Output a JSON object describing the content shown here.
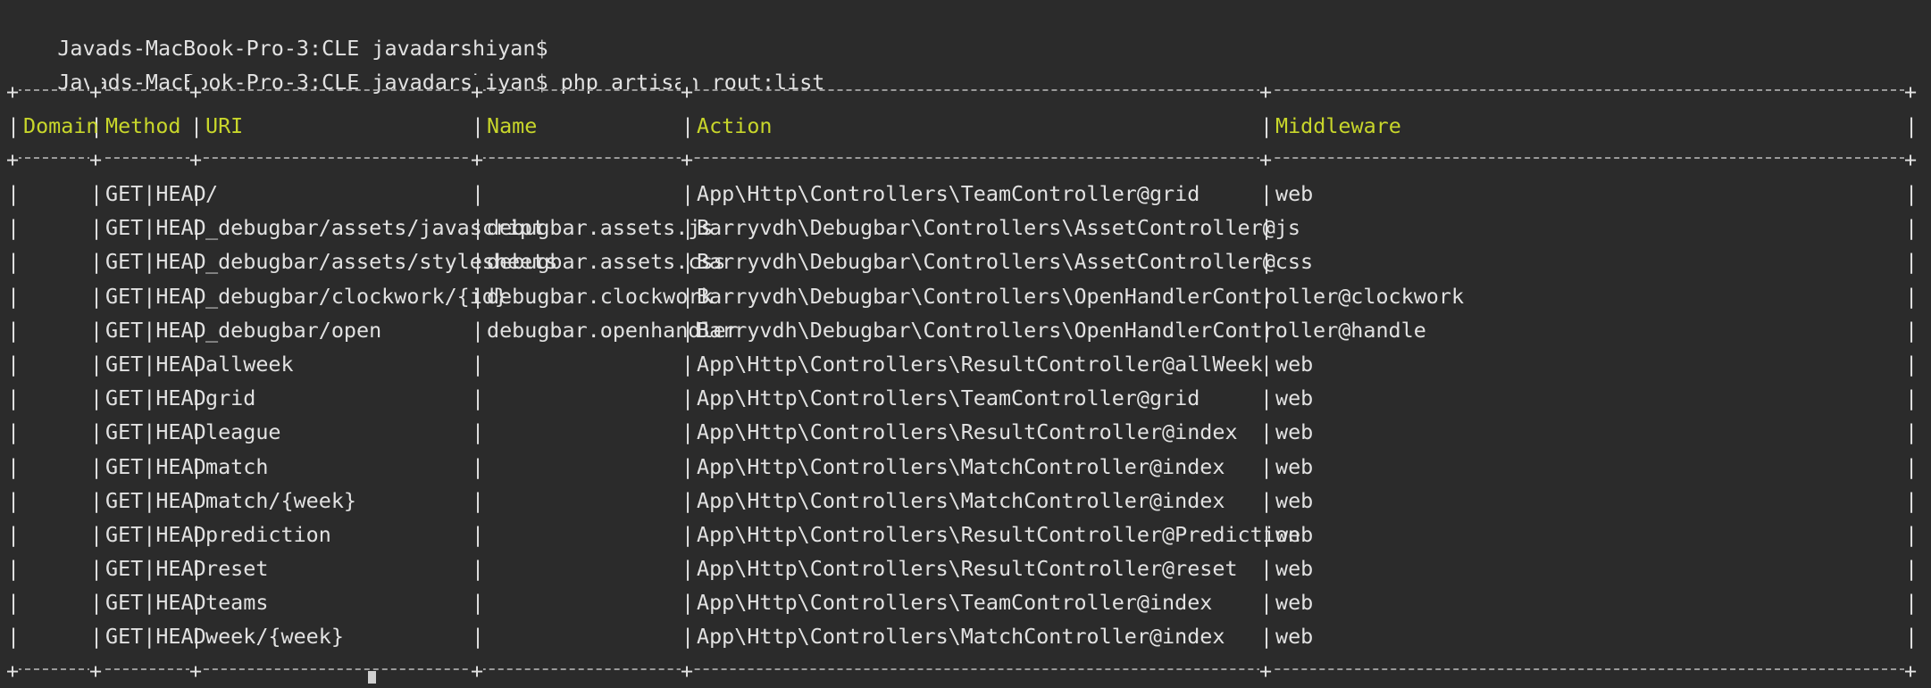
{
  "terminal": {
    "line1": "Javads-MacBook-Pro-3:CLE javadarshiyan$",
    "line2_prompt": "Javads-MacBook-Pro-3:CLE javadarshiyan$",
    "line2_command": " php artisan rout:list"
  },
  "table": {
    "headers": {
      "domain": "Domain",
      "method": "Method",
      "uri": "URI",
      "name": "Name",
      "action": "Action",
      "middleware": "Middleware"
    },
    "rows": [
      {
        "domain": "",
        "method": "GET|HEAD",
        "uri": "/",
        "name": "",
        "action": "App\\Http\\Controllers\\TeamController@grid",
        "middleware": "web"
      },
      {
        "domain": "",
        "method": "GET|HEAD",
        "uri": "_debugbar/assets/javascript",
        "name": "debugbar.assets.js",
        "action": "Barryvdh\\Debugbar\\Controllers\\AssetController@js",
        "middleware": ""
      },
      {
        "domain": "",
        "method": "GET|HEAD",
        "uri": "_debugbar/assets/stylesheets",
        "name": "debugbar.assets.css",
        "action": "Barryvdh\\Debugbar\\Controllers\\AssetController@css",
        "middleware": ""
      },
      {
        "domain": "",
        "method": "GET|HEAD",
        "uri": "_debugbar/clockwork/{id}",
        "name": "debugbar.clockwork",
        "action": "Barryvdh\\Debugbar\\Controllers\\OpenHandlerController@clockwork",
        "middleware": ""
      },
      {
        "domain": "",
        "method": "GET|HEAD",
        "uri": "_debugbar/open",
        "name": "debugbar.openhandler",
        "action": "Barryvdh\\Debugbar\\Controllers\\OpenHandlerController@handle",
        "middleware": ""
      },
      {
        "domain": "",
        "method": "GET|HEAD",
        "uri": "allweek",
        "name": "",
        "action": "App\\Http\\Controllers\\ResultController@allWeek",
        "middleware": "web"
      },
      {
        "domain": "",
        "method": "GET|HEAD",
        "uri": "grid",
        "name": "",
        "action": "App\\Http\\Controllers\\TeamController@grid",
        "middleware": "web"
      },
      {
        "domain": "",
        "method": "GET|HEAD",
        "uri": "league",
        "name": "",
        "action": "App\\Http\\Controllers\\ResultController@index",
        "middleware": "web"
      },
      {
        "domain": "",
        "method": "GET|HEAD",
        "uri": "match",
        "name": "",
        "action": "App\\Http\\Controllers\\MatchController@index",
        "middleware": "web"
      },
      {
        "domain": "",
        "method": "GET|HEAD",
        "uri": "match/{week}",
        "name": "",
        "action": "App\\Http\\Controllers\\MatchController@index",
        "middleware": "web"
      },
      {
        "domain": "",
        "method": "GET|HEAD",
        "uri": "prediction",
        "name": "",
        "action": "App\\Http\\Controllers\\ResultController@Prediction",
        "middleware": "web"
      },
      {
        "domain": "",
        "method": "GET|HEAD",
        "uri": "reset",
        "name": "",
        "action": "App\\Http\\Controllers\\ResultController@reset",
        "middleware": "web"
      },
      {
        "domain": "",
        "method": "GET|HEAD",
        "uri": "teams",
        "name": "",
        "action": "App\\Http\\Controllers\\TeamController@index",
        "middleware": "web"
      },
      {
        "domain": "",
        "method": "GET|HEAD",
        "uri": "week/{week}",
        "name": "",
        "action": "App\\Http\\Controllers\\MatchController@index",
        "middleware": "web"
      }
    ]
  },
  "colors": {
    "background": "#2b2b2b",
    "text": "#e2e2e2",
    "header_text": "#c8d62b",
    "border": "#9a9a9a"
  }
}
